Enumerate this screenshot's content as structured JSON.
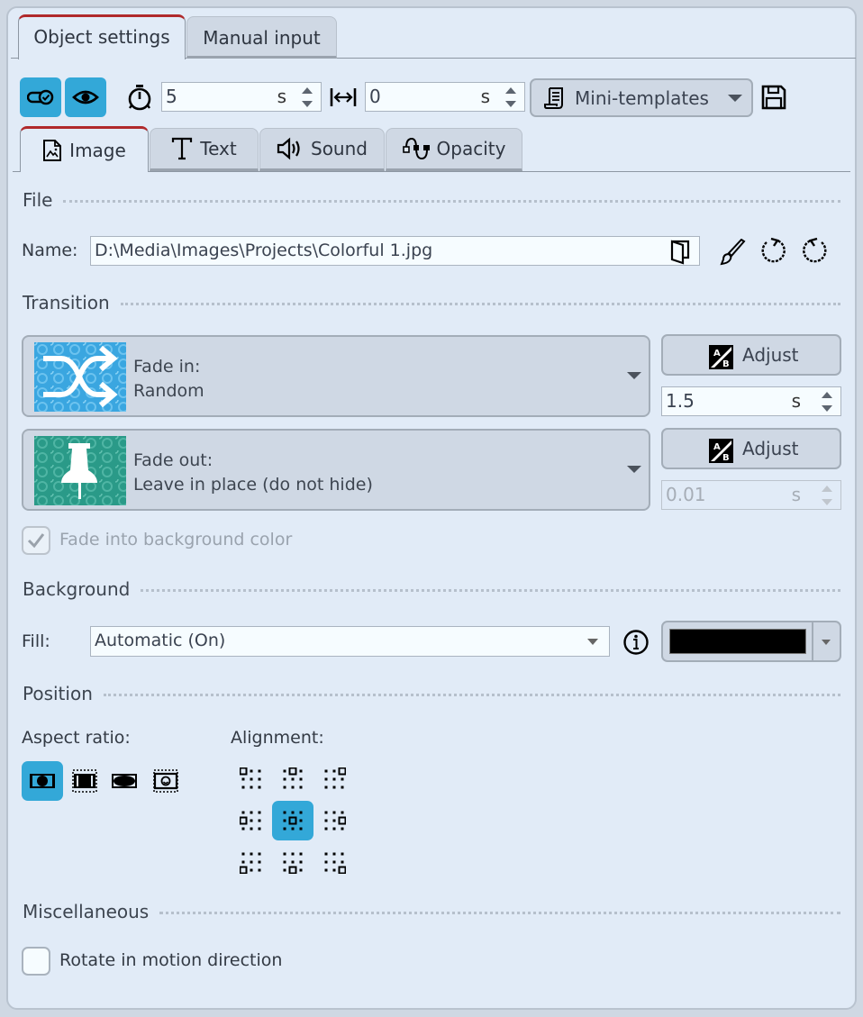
{
  "top_tabs": [
    {
      "label": "Object settings",
      "active": true
    },
    {
      "label": "Manual input",
      "active": false
    }
  ],
  "toolbar": {
    "toggle_icon": "toggle-check-icon",
    "visibility_icon": "eye-icon",
    "duration_icon": "stopwatch-icon",
    "duration_value": "5",
    "duration_unit": "s",
    "offset_icon": "width-arrows-icon",
    "offset_value": "0",
    "offset_unit": "s",
    "mini_templates_label": "Mini-templates",
    "mini_templates_icon": "scroll-icon",
    "save_icon": "floppy-disk-icon"
  },
  "sub_tabs": [
    {
      "label": "Image",
      "icon": "image-file-icon",
      "active": true
    },
    {
      "label": "Text",
      "icon": "text-icon",
      "active": false
    },
    {
      "label": "Sound",
      "icon": "speaker-icon",
      "active": false
    },
    {
      "label": "Opacity",
      "icon": "opacity-curve-icon",
      "active": false
    }
  ],
  "file": {
    "section_title": "File",
    "name_label": "Name:",
    "name_value": "D:\\Media\\Images\\Projects\\Colorful 1.jpg",
    "browse_icon": "open-folder-icon",
    "edit_icon": "paintbrush-icon",
    "rotate_left_icon": "rotate-left-icon",
    "rotate_right_icon": "rotate-right-icon"
  },
  "transition": {
    "section_title": "Transition",
    "fade_in": {
      "title": "Fade in:",
      "value": "Random",
      "thumb_icon": "shuffle-icon",
      "thumb_color": "#3aa6e0"
    },
    "fade_in_adjust_label": "Adjust",
    "fade_in_duration": "1.5",
    "fade_in_unit": "s",
    "fade_out": {
      "title": "Fade out:",
      "value": "Leave in place (do not hide)",
      "thumb_icon": "pushpin-icon",
      "thumb_color": "#2a9a88"
    },
    "fade_out_adjust_label": "Adjust",
    "fade_out_duration": "0.01",
    "fade_out_unit": "s",
    "fade_bg_label": "Fade into background color",
    "fade_bg_checked": true,
    "fade_bg_disabled": true
  },
  "background": {
    "section_title": "Background",
    "fill_label": "Fill:",
    "fill_value": "Automatic (On)",
    "info_icon": "info-icon",
    "color_value": "#000000"
  },
  "position": {
    "section_title": "Position",
    "aspect_label": "Aspect ratio:",
    "aspect_options": [
      "fit-icon",
      "fill-crop-icon",
      "stretch-icon",
      "original-size-icon"
    ],
    "aspect_selected": 0,
    "alignment_label": "Alignment:",
    "alignment_options": [
      "top-left",
      "top-center",
      "top-right",
      "middle-left",
      "center",
      "middle-right",
      "bottom-left",
      "bottom-center",
      "bottom-right"
    ],
    "alignment_selected": 4
  },
  "misc": {
    "section_title": "Miscellaneous",
    "rotate_label": "Rotate in motion direction",
    "rotate_checked": false
  },
  "colors": {
    "accent": "#33a8d8",
    "tab_active_bar": "#b0292b",
    "panel_bg": "#e1ebf7"
  }
}
